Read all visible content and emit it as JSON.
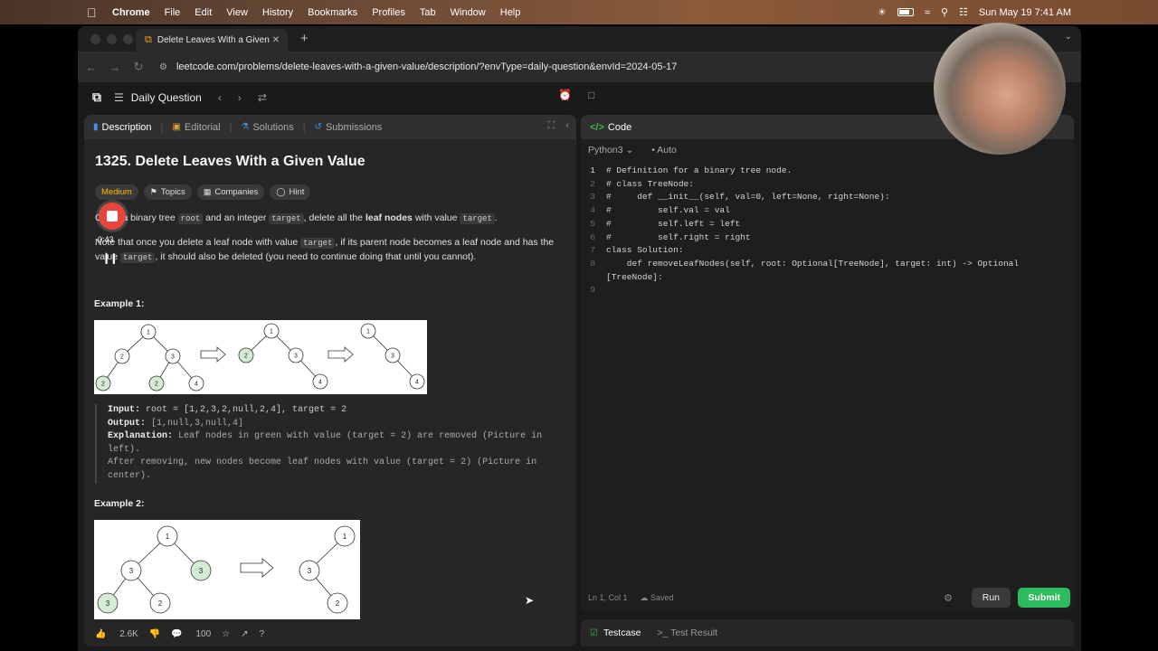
{
  "menubar": {
    "app": "Chrome",
    "items": [
      "File",
      "Edit",
      "View",
      "History",
      "Bookmarks",
      "Profiles",
      "Tab",
      "Window",
      "Help"
    ],
    "clock": "Sun May 19  7:41 AM"
  },
  "browser": {
    "tab_title": "Delete Leaves With a Given V",
    "url": "leetcode.com/problems/delete-leaves-with-a-given-value/description/?envType=daily-question&envId=2024-05-17"
  },
  "lc": {
    "daily_label": "Daily Question"
  },
  "left_tabs": [
    "Description",
    "Editorial",
    "Solutions",
    "Submissions"
  ],
  "problem": {
    "title": "1325. Delete Leaves With a Given Value",
    "difficulty": "Medium",
    "chips": [
      "Topics",
      "Companies",
      "Hint"
    ],
    "p1_a": "Given a binary tree",
    "p1_root": "root",
    "p1_b": "and an integer",
    "p1_target": "target",
    "p1_c": ", delete all the",
    "p1_bold": "leaf nodes",
    "p1_d": "with value",
    "p1_target2": "target",
    "p1_e": ".",
    "p2_a": "Note that once you delete a leaf node with value",
    "p2_target": "target",
    "p2_b": ", if its parent node becomes a leaf node and has the value",
    "p2_target2": "target",
    "p2_c": ", it should also be deleted (you need to continue doing that until you cannot).",
    "example1_label": "Example 1:",
    "ex1_input_label": "Input:",
    "ex1_input": "root = [1,2,3,2,null,2,4], target = 2",
    "ex1_output_label": "Output:",
    "ex1_output": "[1,null,3,null,4]",
    "ex1_expl_label": "Explanation:",
    "ex1_expl": "Leaf nodes in green with value (target = 2) are removed (Picture in left).",
    "ex1_expl2": "After removing, new nodes become leaf nodes with value (target = 2) (Picture in center).",
    "example2_label": "Example 2:",
    "tree_labels": {
      "one": "1",
      "two": "2",
      "three": "3",
      "four": "4"
    }
  },
  "recording": {
    "time": "0:43"
  },
  "footer": {
    "likes": "2.6K",
    "comments": "100"
  },
  "editor": {
    "title": "Code",
    "language": "Python3",
    "mode": "Auto",
    "status_pos": "Ln 1, Col 1",
    "status_saved": "Saved",
    "run_label": "Run",
    "submit_label": "Submit",
    "lines": [
      "# Definition for a binary tree node.",
      "# class TreeNode:",
      "#     def __init__(self, val=0, left=None, right=None):",
      "#         self.val = val",
      "#         self.left = left",
      "#         self.right = right",
      "class Solution:",
      "    def removeLeafNodes(self, root: Optional[TreeNode], target: int) -> Optional",
      "[TreeNode]:",
      ""
    ],
    "line_numbers": [
      "1",
      "2",
      "3",
      "4",
      "5",
      "6",
      "7",
      "8",
      "",
      "9"
    ]
  },
  "bottom": {
    "testcase": "Testcase",
    "test_result": "Test Result"
  },
  "colors": {
    "accent_green": "#2cbb5d",
    "medium": "#ffb800",
    "record": "#e8453c"
  }
}
